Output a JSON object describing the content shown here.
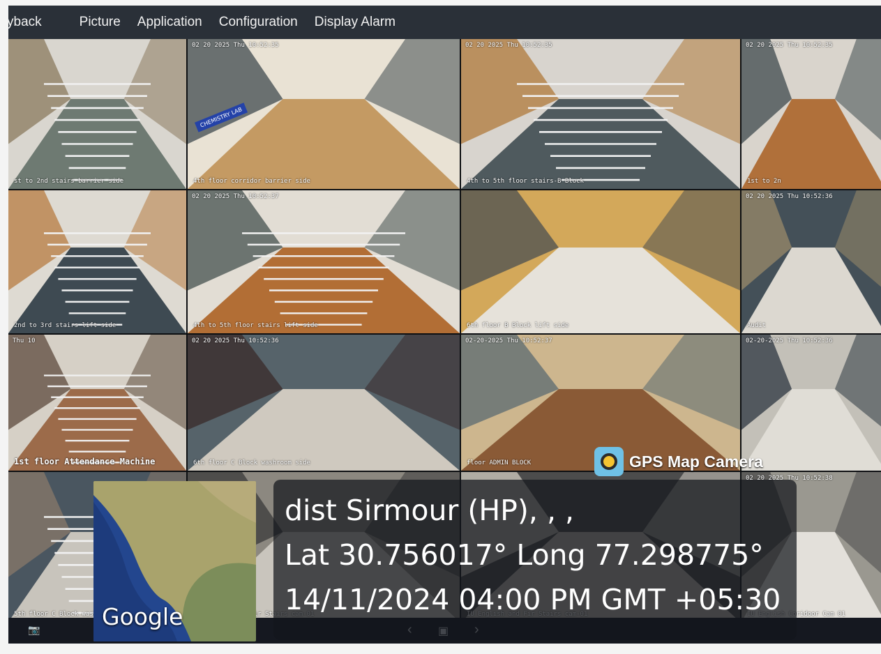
{
  "menu": [
    "yback",
    "Picture",
    "Application",
    "Configuration",
    "Display Alarm"
  ],
  "cameras": [
    {
      "ts": "",
      "name": "st to 2nd stairs barrier side"
    },
    {
      "ts": "02 20 2025 Thu 10:52:35",
      "name": "4th floor corridor barrier side",
      "sign": "CHEMISTRY LAB"
    },
    {
      "ts": "02 20 2025 Thu 10:52:35",
      "name": "4th to 5th floor stairs-B Block"
    },
    {
      "ts": "02 20 2025 Thu 10:52:35",
      "name": "1st to 2n"
    },
    {
      "ts": "",
      "name": "2nd to 3rd stairs lift side"
    },
    {
      "ts": "02 20 2025 Thu 10:52:37",
      "name": "4th to 5th floor stairs lift side"
    },
    {
      "ts": "",
      "name": "6th floor B Block lift side"
    },
    {
      "ts": "02 20 2025 Thu 10:52:36",
      "name": "Audit"
    },
    {
      "ts": "Thu 10",
      "name": "1st floor Attendance Machine"
    },
    {
      "ts": "02 20 2025 Thu 10:52:36",
      "name": "6th floor C Block washroom side"
    },
    {
      "ts": "02-20-2025 Thu 10:52:37",
      "name": "floor ADMIN BLOCK"
    },
    {
      "ts": "02-20-2025 Thu 10:52:36",
      "name": ""
    },
    {
      "ts": "",
      "name": "5th floor C Block washroom"
    },
    {
      "ts": "",
      "name": "IU English and Fir Stairs cam-01"
    },
    {
      "ts": "",
      "name": "IU English and Fir Stairs cam-01"
    },
    {
      "ts": "02 20 2025 Thu 10:52:38",
      "name": "IU English Coridoor Cam 01"
    }
  ],
  "overlay": {
    "brand": "GPS Map Camera",
    "location": "dist Sirmour (HP), , ,",
    "coords": "Lat 30.756017° Long 77.298775°",
    "datetime": "14/11/2024 04:00 PM GMT +05:30",
    "map_label": "Google"
  },
  "bottombar": {
    "camera_icon": "camera-icon",
    "prev": "‹",
    "next": "›"
  }
}
